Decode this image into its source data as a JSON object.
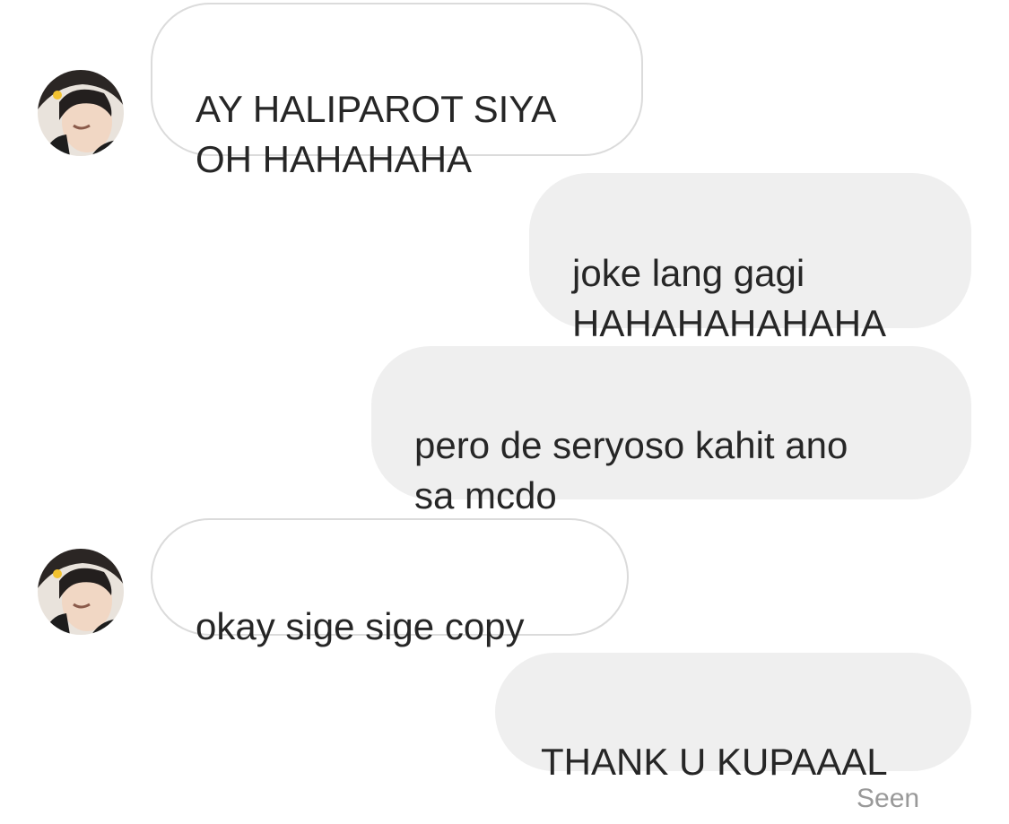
{
  "thread": {
    "messages": [
      {
        "sender": "them",
        "text": "AY HALIPAROT SIYA\nOH HAHAHAHA"
      },
      {
        "sender": "me",
        "text": "joke lang gagi\nHAHAHAHAHAHA"
      },
      {
        "sender": "me",
        "text": "pero de seryoso kahit ano\nsa mcdo"
      },
      {
        "sender": "them",
        "text": "okay sige sige copy"
      },
      {
        "sender": "me",
        "text": "THANK U KUPAAAL"
      }
    ],
    "seen_label": "Seen"
  },
  "colors": {
    "outgoing_bubble": "#efefef",
    "incoming_border": "#dbdbdb",
    "text": "#262626",
    "seen_text": "#999999"
  },
  "icons": {
    "avatar": "user-avatar-photo"
  }
}
